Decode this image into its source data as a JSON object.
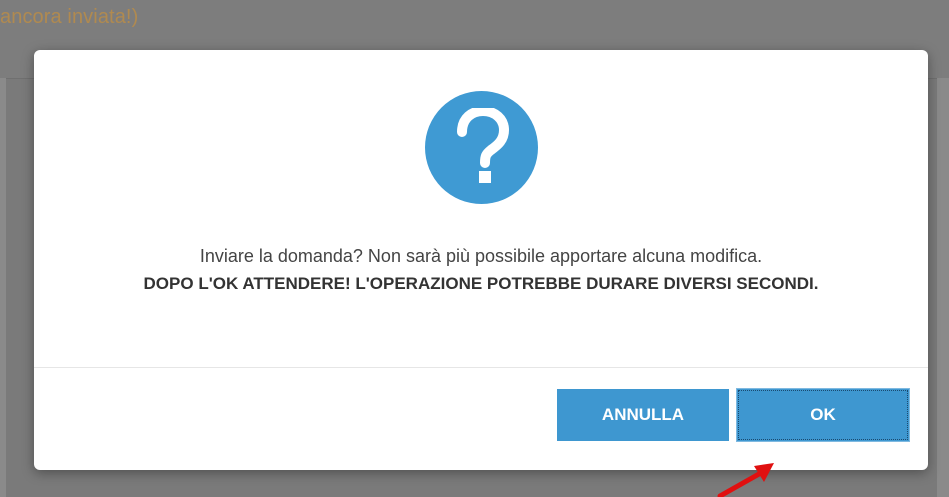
{
  "background": {
    "title_fragment": "ancora inviata!)"
  },
  "dialog": {
    "icon": "question-icon",
    "message_line1": "Inviare la domanda? Non sarà più possibile apportare alcuna modifica.",
    "message_line2": "DOPO L'OK ATTENDERE! L'OPERAZIONE POTREBBE DURARE DIVERSI SECONDI.",
    "cancel_label": "ANNULLA",
    "ok_label": "OK"
  },
  "colors": {
    "accent": "#3e97d0",
    "overlay": "#7a7a7a",
    "title_text": "#b08a50",
    "annotation_arrow": "#e01010"
  }
}
